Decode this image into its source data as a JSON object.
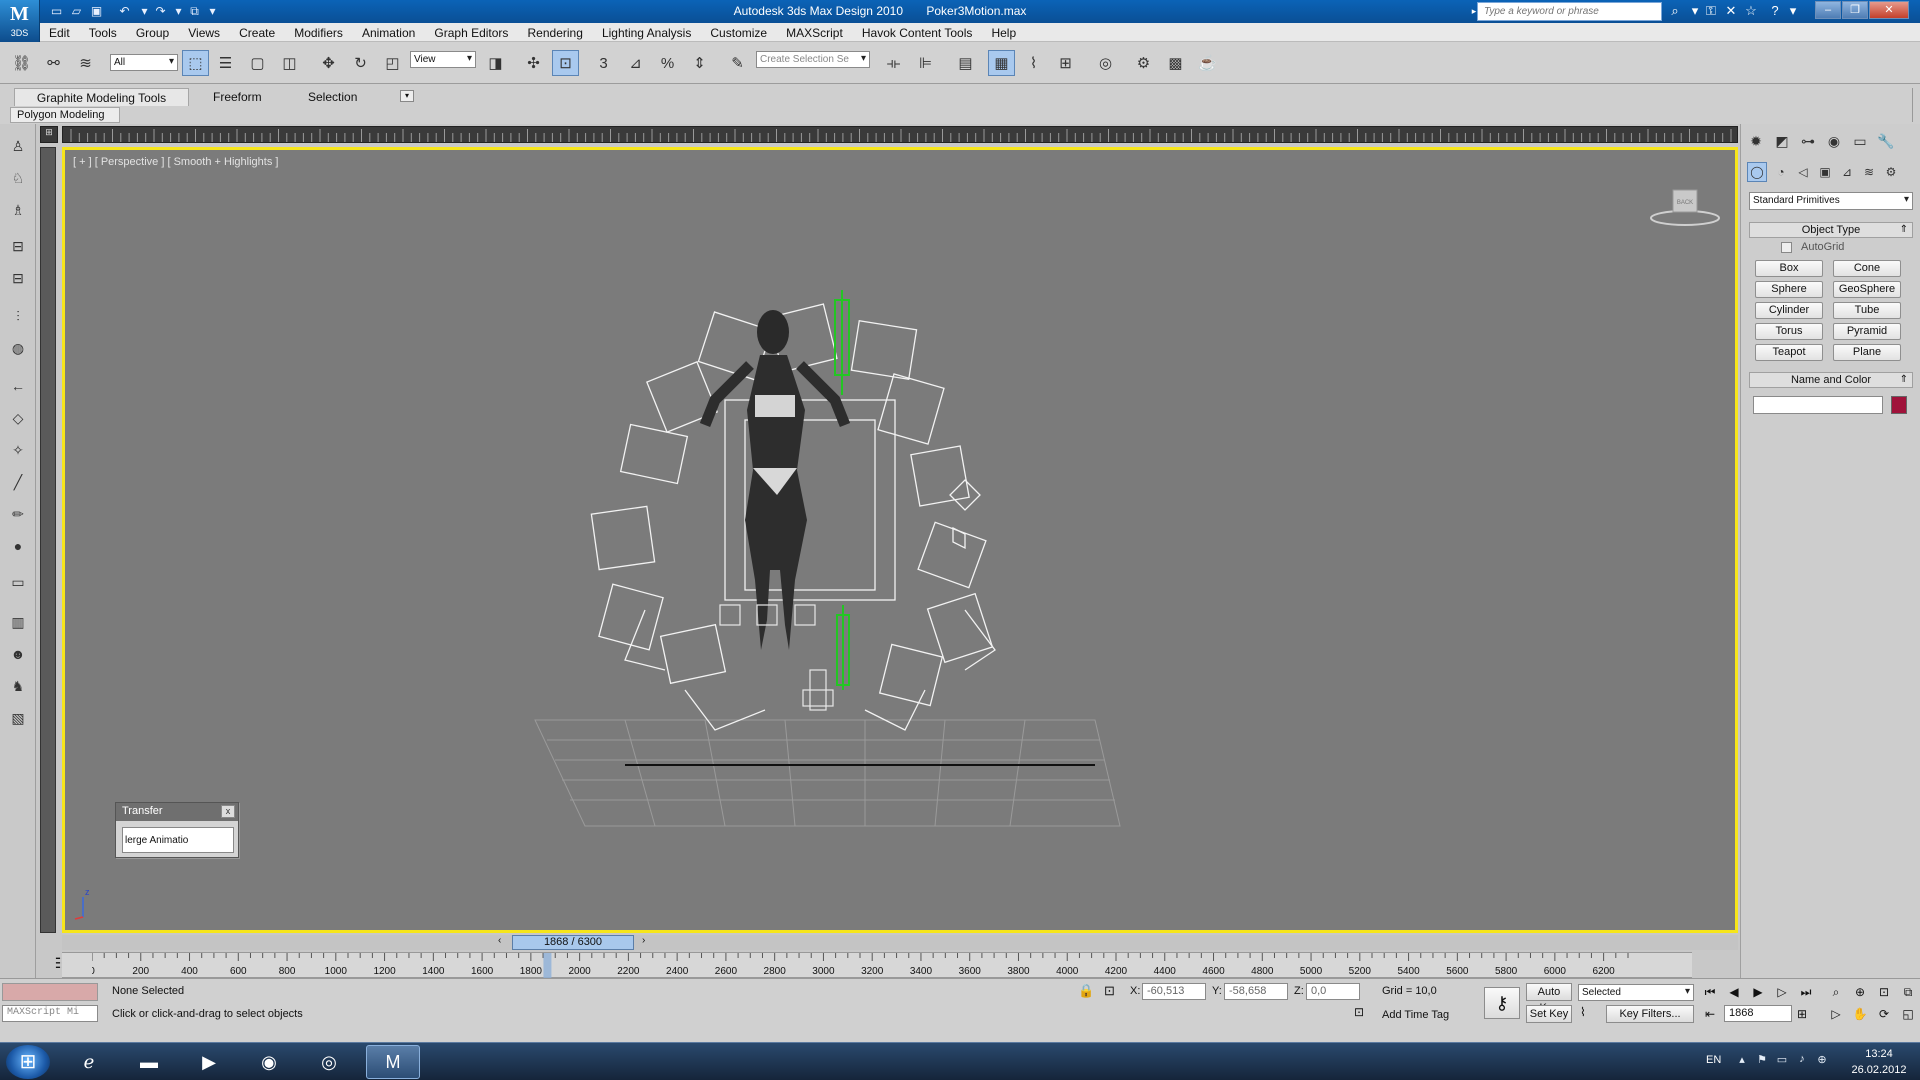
{
  "window": {
    "app_title": "Autodesk 3ds Max Design 2010",
    "file_name": "Poker3Motion.max",
    "search_placeholder": "Type a keyword or phrase",
    "logo_text": "3DS"
  },
  "menu": [
    "Edit",
    "Tools",
    "Group",
    "Views",
    "Create",
    "Modifiers",
    "Animation",
    "Graph Editors",
    "Rendering",
    "Lighting Analysis",
    "Customize",
    "MAXScript",
    "Havok Content Tools",
    "Help"
  ],
  "toolbar": {
    "selection_filter": "All",
    "ref_coord": "View",
    "named_selection_placeholder": "Create Selection Se"
  },
  "ribbon": {
    "tabs": [
      "Graphite Modeling Tools",
      "Freeform",
      "Selection"
    ],
    "panel": "Polygon Modeling"
  },
  "viewport": {
    "label": "[ + ] [ Perspective ] [ Smooth + Highlights ]",
    "viewcube_face": "BACK",
    "axis_z": "z"
  },
  "transfer_dialog": {
    "title": "Transfer",
    "close": "x",
    "text": "lerge Animatio"
  },
  "command_panel": {
    "category": "Standard Primitives",
    "rollouts": {
      "object_type": "Object Type",
      "name_and_color": "Name and Color",
      "autogrid": "AutoGrid"
    },
    "objects": [
      "Box",
      "Cone",
      "Sphere",
      "GeoSphere",
      "Cylinder",
      "Tube",
      "Torus",
      "Pyramid",
      "Teapot",
      "Plane"
    ],
    "object_color": "#a0123a"
  },
  "timeline": {
    "frame_display": "1868 / 6300",
    "current_frame": 1868,
    "total_frames": 6300,
    "ticks": [
      "0",
      "200",
      "400",
      "600",
      "800",
      "1000",
      "1200",
      "1400",
      "1600",
      "1800",
      "2000",
      "2200",
      "2400",
      "2600",
      "2800",
      "3000",
      "3200",
      "3400",
      "3600",
      "3800",
      "4000",
      "4200",
      "4400",
      "4600",
      "4800",
      "5000",
      "5200",
      "5400",
      "5600",
      "5800",
      "6000",
      "6200"
    ]
  },
  "status": {
    "maxscript": "MAXScript Mi",
    "selection": "None Selected",
    "prompt": "Click or click-and-drag to select objects",
    "x_label": "X:",
    "x_value": "-60,513",
    "y_label": "Y:",
    "y_value": "-58,658",
    "z_label": "Z:",
    "z_value": "0,0",
    "grid": "Grid = 10,0",
    "add_time_tag": "Add Time Tag",
    "auto_key": "Auto Key",
    "set_key": "Set Key",
    "key_mode": "Selected",
    "key_filters": "Key Filters...",
    "frame_field": "1868"
  },
  "taskbar": {
    "lang": "EN",
    "time": "13:24",
    "date": "26.02.2012"
  }
}
